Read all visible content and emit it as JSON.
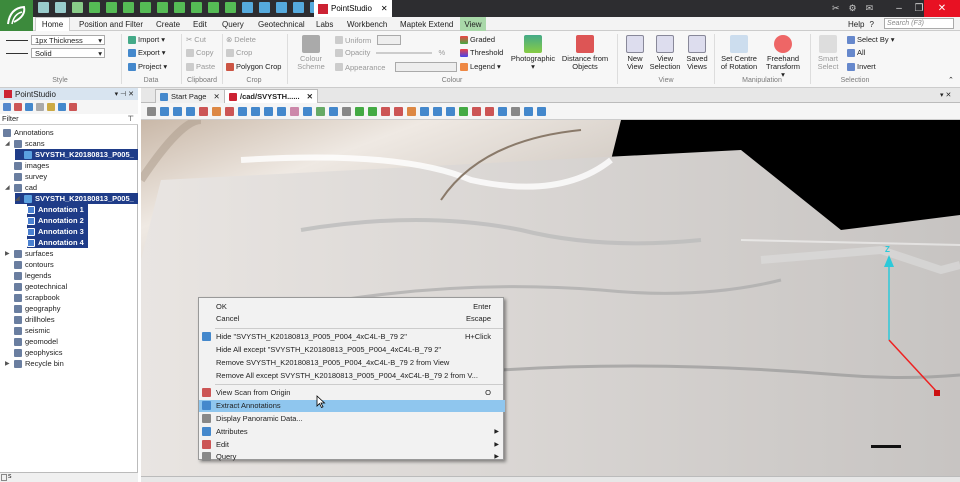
{
  "app": {
    "title": "PointStudio",
    "doc_tab": "PointStudio"
  },
  "menu": {
    "tabs": [
      "Home",
      "Position and Filter",
      "Create",
      "Edit",
      "Query",
      "Geotechnical",
      "Labs",
      "Workbench",
      "Maptek Extend",
      "View"
    ],
    "active": "Home",
    "help": "Help",
    "search_placeholder": "Search (F3)"
  },
  "ribbon": {
    "style": {
      "thickness": "1px Thickness",
      "line": "Solid",
      "group": "Style"
    },
    "data": {
      "import": "Import",
      "export": "Export",
      "project": "Project",
      "group": "Data"
    },
    "clipboard": {
      "cut": "Cut",
      "copy": "Copy",
      "paste": "Paste",
      "group": "Clipboard"
    },
    "crop": {
      "delete": "Delete",
      "crop": "Crop",
      "polygon_crop": "Polygon Crop",
      "group": "Crop"
    },
    "colour": {
      "colour_scheme": "Colour Scheme",
      "uniform": "Uniform",
      "opacity": "Opacity",
      "opacity_unit": "%",
      "appearance": "Appearance",
      "graded": "Graded",
      "threshold": "Threshold",
      "legend": "Legend",
      "photographic": "Photographic",
      "distance": "Distance from Objects",
      "group": "Colour"
    },
    "view": {
      "new_view": "New View",
      "view_selection": "View Selection",
      "saved_views": "Saved Views",
      "group": "View"
    },
    "manipulation": {
      "set_centre": "Set Centre of Rotation",
      "freehand": "Freehand Transform",
      "group": "Manipulation"
    },
    "selection": {
      "smart_select": "Smart Select",
      "select_by": "Select By",
      "all": "All",
      "invert": "Invert",
      "group": "Selection"
    }
  },
  "left_panel": {
    "title": "PointStudio",
    "filter": "Filter",
    "tree": [
      {
        "label": "Annotations",
        "indent": 0,
        "icon": "folder",
        "selected": false
      },
      {
        "label": "scans",
        "indent": 1,
        "icon": "folder",
        "selected": false
      },
      {
        "label": "SVYSTH_K20180813_P005_",
        "indent": 2,
        "icon": "scan",
        "selected": true
      },
      {
        "label": "images",
        "indent": 1,
        "icon": "folder",
        "selected": false
      },
      {
        "label": "survey",
        "indent": 1,
        "icon": "folder",
        "selected": false
      },
      {
        "label": "cad",
        "indent": 1,
        "icon": "folder",
        "selected": false
      },
      {
        "label": "SVYSTH_K20180813_P005_",
        "indent": 2,
        "icon": "scan",
        "selected": true
      },
      {
        "label": "Annotation 1",
        "indent": 3,
        "icon": "grid",
        "selected": true
      },
      {
        "label": "Annotation 2",
        "indent": 3,
        "icon": "grid",
        "selected": true
      },
      {
        "label": "Annotation 3",
        "indent": 3,
        "icon": "grid",
        "selected": true
      },
      {
        "label": "Annotation 4",
        "indent": 3,
        "icon": "grid",
        "selected": true
      },
      {
        "label": "surfaces",
        "indent": 1,
        "icon": "folder",
        "selected": false
      },
      {
        "label": "contours",
        "indent": 1,
        "icon": "folder",
        "selected": false
      },
      {
        "label": "legends",
        "indent": 1,
        "icon": "folder",
        "selected": false
      },
      {
        "label": "geotechnical",
        "indent": 1,
        "icon": "folder",
        "selected": false
      },
      {
        "label": "scrapbook",
        "indent": 1,
        "icon": "folder",
        "selected": false
      },
      {
        "label": "geography",
        "indent": 1,
        "icon": "folder",
        "selected": false
      },
      {
        "label": "drillholes",
        "indent": 1,
        "icon": "folder",
        "selected": false
      },
      {
        "label": "seismic",
        "indent": 1,
        "icon": "folder",
        "selected": false
      },
      {
        "label": "geomodel",
        "indent": 1,
        "icon": "folder",
        "selected": false
      },
      {
        "label": "geophysics",
        "indent": 1,
        "icon": "folder",
        "selected": false
      },
      {
        "label": "Recycle bin",
        "indent": 1,
        "icon": "bin",
        "selected": false
      }
    ],
    "status": "s"
  },
  "view_tabs": [
    {
      "label": "Start Page",
      "active": false
    },
    {
      "label": "/cad/SVYSTH......",
      "active": true
    }
  ],
  "context_menu": {
    "items": [
      {
        "label": "OK",
        "shortcut": "Enter",
        "icon": "",
        "highlight": false,
        "arrow": false
      },
      {
        "label": "Cancel",
        "shortcut": "Escape",
        "icon": "",
        "highlight": false,
        "arrow": false
      },
      {
        "sep": true
      },
      {
        "label": "Hide \"SVYSTH_K20180813_P005_P004_4xC4L-B_79 2\"",
        "shortcut": "H+Click",
        "icon": "hide",
        "highlight": false,
        "arrow": false
      },
      {
        "label": "Hide All except \"SVYSTH_K20180813_P005_P004_4xC4L-B_79 2\"",
        "shortcut": "",
        "icon": "",
        "highlight": false,
        "arrow": false
      },
      {
        "label": "Remove SVYSTH_K20180813_P005_P004_4xC4L-B_79 2 from View",
        "shortcut": "",
        "icon": "",
        "highlight": false,
        "arrow": false
      },
      {
        "label": "Remove All except SVYSTH_K20180813_P005_P004_4xC4L-B_79 2 from V...",
        "shortcut": "",
        "icon": "",
        "highlight": false,
        "arrow": false
      },
      {
        "sep": true
      },
      {
        "label": "View Scan from Origin",
        "shortcut": "O",
        "icon": "scan-origin",
        "highlight": false,
        "arrow": false
      },
      {
        "label": "Extract Annotations",
        "shortcut": "",
        "icon": "extract",
        "highlight": true,
        "arrow": false
      },
      {
        "label": "Display Panoramic Data...",
        "shortcut": "",
        "icon": "panoramic",
        "highlight": false,
        "arrow": false
      },
      {
        "label": "Attributes",
        "shortcut": "",
        "icon": "attributes",
        "highlight": false,
        "arrow": true
      },
      {
        "label": "Edit",
        "shortcut": "",
        "icon": "edit",
        "highlight": false,
        "arrow": true
      },
      {
        "label": "Query",
        "shortcut": "",
        "icon": "query",
        "highlight": false,
        "arrow": true
      }
    ]
  },
  "axis": {
    "z_label": "Z"
  },
  "colors": {
    "selection_bg": "#1f3c88",
    "highlight": "#8fc6ee",
    "brand_green": "#3c8a3c",
    "view_tab": "#a9d8a9",
    "close_red": "#e81123"
  }
}
